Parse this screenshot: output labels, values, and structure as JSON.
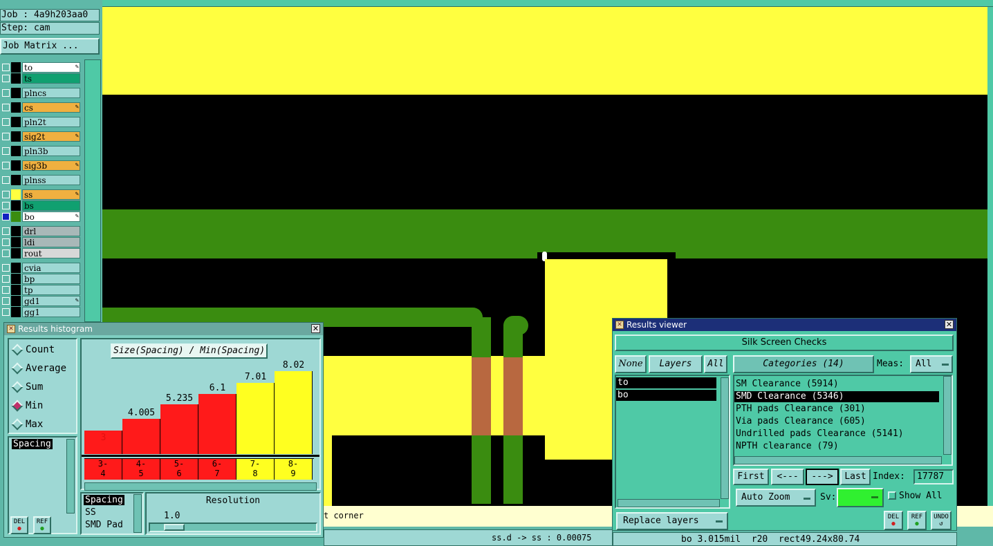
{
  "job": {
    "job_label": "Job : 4a9h203aa0",
    "step_label": "Step: cam",
    "matrix_button": "Job Matrix ..."
  },
  "layers": [
    {
      "name": "to",
      "color": "#ffffff",
      "pen": true
    },
    {
      "name": "ts",
      "color": "#10a070",
      "pen": false
    },
    {
      "name": "plncs",
      "color": "#9ed8d4",
      "pen": false
    },
    {
      "name": "cs",
      "color": "#f0b040",
      "pen": true
    },
    {
      "name": "pln2t",
      "color": "#9ed8d4",
      "pen": false
    },
    {
      "name": "sig2t",
      "color": "#f0b040",
      "pen": true
    },
    {
      "name": "pln3b",
      "color": "#9ed8d4",
      "pen": false
    },
    {
      "name": "sig3b",
      "color": "#f0b040",
      "pen": true
    },
    {
      "name": "plnss",
      "color": "#9ed8d4",
      "pen": false
    },
    {
      "name": "ss",
      "color": "#f0b040",
      "pen": true
    },
    {
      "name": "bs",
      "color": "#10a070",
      "pen": false
    },
    {
      "name": "bo",
      "color": "#ffffff",
      "pen": true
    },
    {
      "name": "drl",
      "color": "#a8b8b8",
      "pen": false
    },
    {
      "name": "ldi",
      "color": "#a8b8b8",
      "pen": false
    },
    {
      "name": "rout",
      "color": "#d8d8d8",
      "pen": false
    },
    {
      "name": "cvia",
      "color": "#9ed8d4",
      "pen": false
    },
    {
      "name": "bp",
      "color": "#9ed8d4",
      "pen": false
    },
    {
      "name": "tp",
      "color": "#9ed8d4",
      "pen": false
    },
    {
      "name": "gd1",
      "color": "#9ed8d4",
      "pen": true
    },
    {
      "name": "gg1",
      "color": "#9ed8d4",
      "pen": false
    }
  ],
  "histogram": {
    "title": "Results histogram",
    "modes": [
      "Count",
      "Average",
      "Sum",
      "Min",
      "Max"
    ],
    "selected_mode": "Min",
    "chart_title": "Size(Spacing) / Min(Spacing)",
    "left_list": [
      "Spacing"
    ],
    "bars": [
      {
        "value": "3",
        "bin": "3-\n4",
        "color": "#ff1a1a"
      },
      {
        "value": "4.005",
        "bin": "4-\n5",
        "color": "#ff1a1a"
      },
      {
        "value": "5.235",
        "bin": "5-\n6",
        "color": "#ff1a1a"
      },
      {
        "value": "6.1",
        "bin": "6-\n7",
        "color": "#ff1a1a"
      },
      {
        "value": "7.01",
        "bin": "7-\n8",
        "color": "#ffff20"
      },
      {
        "value": "8.02",
        "bin": "8-\n9",
        "color": "#ffff20"
      }
    ],
    "bottom_list": [
      "Spacing",
      "SS",
      "SMD Pad"
    ],
    "resolution_label": "Resolution",
    "resolution_value": "1.0",
    "del_label": "DEL",
    "ref_label": "REF"
  },
  "viewer": {
    "title": "Results viewer",
    "check_name": "Silk Screen Checks",
    "none_label": "None",
    "layers_label": "Layers",
    "all_label": "All",
    "categories_label": "Categories (14)",
    "meas_label": "Meas:",
    "meas_value": "All",
    "layer_list": [
      "to",
      "bo"
    ],
    "categories": [
      "SM Clearance (5914)",
      "SMD Clearance (5346)",
      "PTH pads Clearance (301)",
      "Via pads Clearance (605)",
      "Undrilled pads Clearance (5141)",
      "NPTH clearance (79)"
    ],
    "selected_category": 1,
    "first_label": "First",
    "prev_label": "<---",
    "next_label": "--->",
    "last_label": "Last",
    "index_label": "Index:",
    "index_value": "17787",
    "auto_zoom_label": "Auto Zoom",
    "sv_label": "Sv:",
    "show_all_label": "Show All",
    "replace_label": "Replace layers",
    "del_label": "DEL",
    "ref_label": "REF",
    "undo_label": "UNDO"
  },
  "status": {
    "message_tail": "t corner",
    "measure": "ss.d -> ss : 0.00075",
    "feature": "bo 3.015mil  r20  rect49.24x80.74"
  },
  "colors": {
    "panel": "#9ed8d4",
    "canvas_bg": "#000000",
    "copper_yellow": "#ffff40",
    "mask_green": "#3a8c10",
    "pad_brown": "#b86840"
  }
}
